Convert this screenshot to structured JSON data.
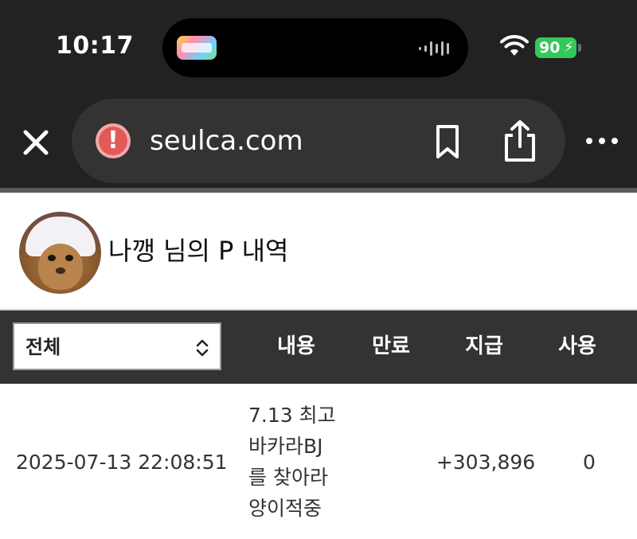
{
  "status_bar": {
    "time": "10:17",
    "battery": "90",
    "icons": [
      "wifi-icon",
      "battery-charging-icon",
      "audio-wave-icon"
    ]
  },
  "browser": {
    "url": "seulca.com",
    "icons": [
      "close-icon",
      "warning-icon",
      "bookmark-icon",
      "share-icon",
      "more-icon"
    ]
  },
  "profile": {
    "title": "나깽 님의 P 내역"
  },
  "table": {
    "filter_value": "전체",
    "headers": {
      "content": "내용",
      "expire": "만료",
      "pay": "지급",
      "use": "사용"
    },
    "rows": [
      {
        "date": "2025-07-13 22:08:51",
        "content": "7.13 최고 바카라BJ 를 찾아라 양이적중",
        "expire": "",
        "pay": "+303,896",
        "use": "0"
      }
    ]
  },
  "colors": {
    "chrome_bg": "#222222",
    "url_bar_bg": "#333333",
    "table_header_bg": "#333333",
    "battery_green": "#34c759",
    "warning_red": "#e05a5a"
  }
}
